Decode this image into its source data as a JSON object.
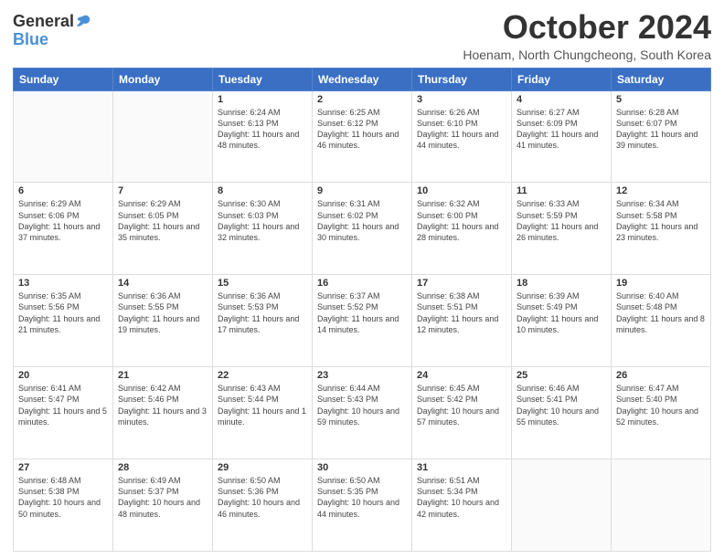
{
  "logo": {
    "line1": "General",
    "line2": "Blue"
  },
  "title": "October 2024",
  "location": "Hoenam, North Chungcheong, South Korea",
  "days_of_week": [
    "Sunday",
    "Monday",
    "Tuesday",
    "Wednesday",
    "Thursday",
    "Friday",
    "Saturday"
  ],
  "weeks": [
    [
      {
        "day": "",
        "info": ""
      },
      {
        "day": "",
        "info": ""
      },
      {
        "day": "1",
        "info": "Sunrise: 6:24 AM\nSunset: 6:13 PM\nDaylight: 11 hours and 48 minutes."
      },
      {
        "day": "2",
        "info": "Sunrise: 6:25 AM\nSunset: 6:12 PM\nDaylight: 11 hours and 46 minutes."
      },
      {
        "day": "3",
        "info": "Sunrise: 6:26 AM\nSunset: 6:10 PM\nDaylight: 11 hours and 44 minutes."
      },
      {
        "day": "4",
        "info": "Sunrise: 6:27 AM\nSunset: 6:09 PM\nDaylight: 11 hours and 41 minutes."
      },
      {
        "day": "5",
        "info": "Sunrise: 6:28 AM\nSunset: 6:07 PM\nDaylight: 11 hours and 39 minutes."
      }
    ],
    [
      {
        "day": "6",
        "info": "Sunrise: 6:29 AM\nSunset: 6:06 PM\nDaylight: 11 hours and 37 minutes."
      },
      {
        "day": "7",
        "info": "Sunrise: 6:29 AM\nSunset: 6:05 PM\nDaylight: 11 hours and 35 minutes."
      },
      {
        "day": "8",
        "info": "Sunrise: 6:30 AM\nSunset: 6:03 PM\nDaylight: 11 hours and 32 minutes."
      },
      {
        "day": "9",
        "info": "Sunrise: 6:31 AM\nSunset: 6:02 PM\nDaylight: 11 hours and 30 minutes."
      },
      {
        "day": "10",
        "info": "Sunrise: 6:32 AM\nSunset: 6:00 PM\nDaylight: 11 hours and 28 minutes."
      },
      {
        "day": "11",
        "info": "Sunrise: 6:33 AM\nSunset: 5:59 PM\nDaylight: 11 hours and 26 minutes."
      },
      {
        "day": "12",
        "info": "Sunrise: 6:34 AM\nSunset: 5:58 PM\nDaylight: 11 hours and 23 minutes."
      }
    ],
    [
      {
        "day": "13",
        "info": "Sunrise: 6:35 AM\nSunset: 5:56 PM\nDaylight: 11 hours and 21 minutes."
      },
      {
        "day": "14",
        "info": "Sunrise: 6:36 AM\nSunset: 5:55 PM\nDaylight: 11 hours and 19 minutes."
      },
      {
        "day": "15",
        "info": "Sunrise: 6:36 AM\nSunset: 5:53 PM\nDaylight: 11 hours and 17 minutes."
      },
      {
        "day": "16",
        "info": "Sunrise: 6:37 AM\nSunset: 5:52 PM\nDaylight: 11 hours and 14 minutes."
      },
      {
        "day": "17",
        "info": "Sunrise: 6:38 AM\nSunset: 5:51 PM\nDaylight: 11 hours and 12 minutes."
      },
      {
        "day": "18",
        "info": "Sunrise: 6:39 AM\nSunset: 5:49 PM\nDaylight: 11 hours and 10 minutes."
      },
      {
        "day": "19",
        "info": "Sunrise: 6:40 AM\nSunset: 5:48 PM\nDaylight: 11 hours and 8 minutes."
      }
    ],
    [
      {
        "day": "20",
        "info": "Sunrise: 6:41 AM\nSunset: 5:47 PM\nDaylight: 11 hours and 5 minutes."
      },
      {
        "day": "21",
        "info": "Sunrise: 6:42 AM\nSunset: 5:46 PM\nDaylight: 11 hours and 3 minutes."
      },
      {
        "day": "22",
        "info": "Sunrise: 6:43 AM\nSunset: 5:44 PM\nDaylight: 11 hours and 1 minute."
      },
      {
        "day": "23",
        "info": "Sunrise: 6:44 AM\nSunset: 5:43 PM\nDaylight: 10 hours and 59 minutes."
      },
      {
        "day": "24",
        "info": "Sunrise: 6:45 AM\nSunset: 5:42 PM\nDaylight: 10 hours and 57 minutes."
      },
      {
        "day": "25",
        "info": "Sunrise: 6:46 AM\nSunset: 5:41 PM\nDaylight: 10 hours and 55 minutes."
      },
      {
        "day": "26",
        "info": "Sunrise: 6:47 AM\nSunset: 5:40 PM\nDaylight: 10 hours and 52 minutes."
      }
    ],
    [
      {
        "day": "27",
        "info": "Sunrise: 6:48 AM\nSunset: 5:38 PM\nDaylight: 10 hours and 50 minutes."
      },
      {
        "day": "28",
        "info": "Sunrise: 6:49 AM\nSunset: 5:37 PM\nDaylight: 10 hours and 48 minutes."
      },
      {
        "day": "29",
        "info": "Sunrise: 6:50 AM\nSunset: 5:36 PM\nDaylight: 10 hours and 46 minutes."
      },
      {
        "day": "30",
        "info": "Sunrise: 6:50 AM\nSunset: 5:35 PM\nDaylight: 10 hours and 44 minutes."
      },
      {
        "day": "31",
        "info": "Sunrise: 6:51 AM\nSunset: 5:34 PM\nDaylight: 10 hours and 42 minutes."
      },
      {
        "day": "",
        "info": ""
      },
      {
        "day": "",
        "info": ""
      }
    ]
  ]
}
